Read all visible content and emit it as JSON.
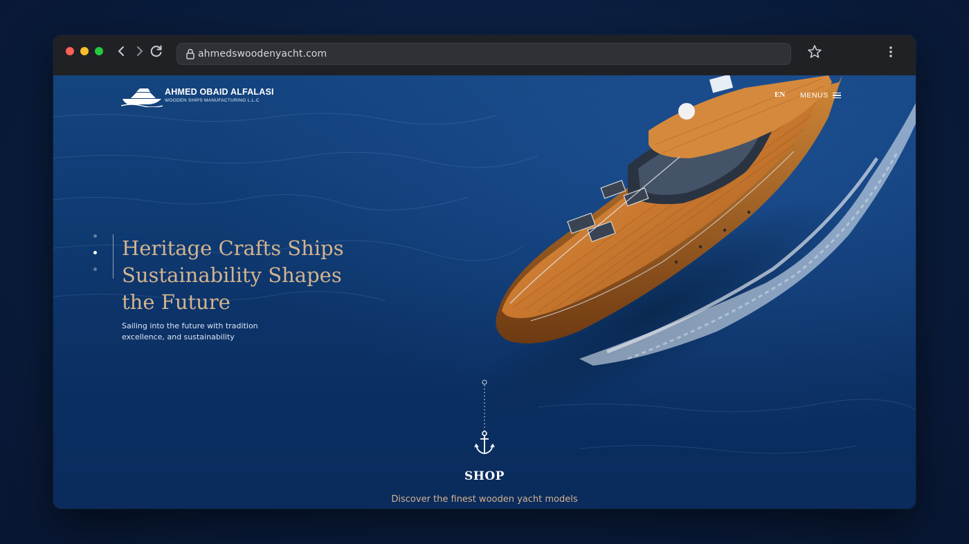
{
  "browser": {
    "url": "ahmedswoodenyacht.com",
    "back_icon": "chevron-left-icon",
    "forward_icon": "chevron-right-icon",
    "reload_icon": "reload-icon",
    "bookmark_icon": "star-icon",
    "menu_icon": "kebab-menu-icon"
  },
  "site": {
    "brand_name": "AHMED OBAID ALFALASI",
    "brand_tagline": "WOODEN SHIPS MANUFACTURING L.L.C",
    "lang": "EN",
    "menu_label": "MENUS"
  },
  "hero": {
    "title_lines": [
      "Heritage Crafts Ships",
      "Sustainability Shapes",
      "the Future"
    ],
    "subtitle_lines": [
      "Sailing into the future with tradition",
      "excellence, and sustainability"
    ],
    "slides_count": 3,
    "active_slide": 2
  },
  "shop": {
    "title": "SHOP",
    "subtitle": "Discover the finest wooden yacht models"
  },
  "colors": {
    "accent_gold": "#d4b48f",
    "sea_blue": "#0f3a72"
  }
}
